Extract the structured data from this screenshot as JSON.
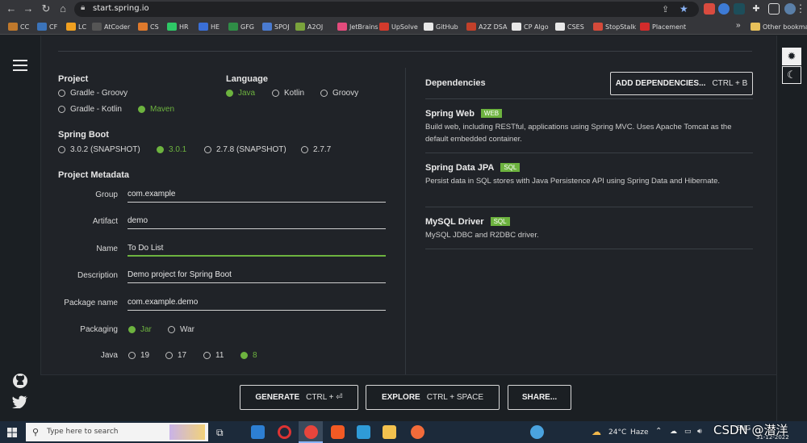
{
  "browser": {
    "url": "start.spring.io",
    "bookmarks": [
      {
        "label": "CC",
        "color": "#c0792c"
      },
      {
        "label": "CF",
        "color": "#3b73b9"
      },
      {
        "label": "LC",
        "color": "#f0a020"
      },
      {
        "label": "AtCoder",
        "color": "#555555"
      },
      {
        "label": "CS",
        "color": "#e07a2c"
      },
      {
        "label": "HR",
        "color": "#2ec866"
      },
      {
        "label": "HE",
        "color": "#3a6fd8"
      },
      {
        "label": "GFG",
        "color": "#2f8d46"
      },
      {
        "label": "SPOJ",
        "color": "#4a7bd0"
      },
      {
        "label": "A2OJ",
        "color": "#7aa33c"
      },
      {
        "label": "JetBrains",
        "color": "#e34b7c"
      },
      {
        "label": "UpSolve",
        "color": "#d33a2c"
      },
      {
        "label": "GitHub",
        "color": "#e8e8e8"
      },
      {
        "label": "A2Z DSA",
        "color": "#c2402a"
      },
      {
        "label": "CP Algo",
        "color": "#e8e8e8"
      },
      {
        "label": "CSES",
        "color": "#e8e8e8"
      },
      {
        "label": "StopStalk",
        "color": "#d44a3a"
      },
      {
        "label": "Placement",
        "color": "#d22b2b"
      }
    ],
    "overflow": "»",
    "other_bookmarks": "Other bookmarks"
  },
  "project": {
    "title": "Project",
    "options": [
      {
        "label": "Gradle - Groovy",
        "selected": false
      },
      {
        "label": "Gradle - Kotlin",
        "selected": false
      },
      {
        "label": "Maven",
        "selected": true
      }
    ]
  },
  "language": {
    "title": "Language",
    "options": [
      {
        "label": "Java",
        "selected": true
      },
      {
        "label": "Kotlin",
        "selected": false
      },
      {
        "label": "Groovy",
        "selected": false
      }
    ]
  },
  "spring_boot": {
    "title": "Spring Boot",
    "options": [
      {
        "label": "3.0.2 (SNAPSHOT)",
        "selected": false
      },
      {
        "label": "3.0.1",
        "selected": true
      },
      {
        "label": "2.7.8 (SNAPSHOT)",
        "selected": false
      },
      {
        "label": "2.7.7",
        "selected": false
      }
    ]
  },
  "metadata": {
    "title": "Project Metadata",
    "fields": [
      {
        "label": "Group",
        "value": "com.example"
      },
      {
        "label": "Artifact",
        "value": "demo"
      },
      {
        "label": "Name",
        "value": "To Do List"
      },
      {
        "label": "Description",
        "value": "Demo project for Spring Boot"
      },
      {
        "label": "Package name",
        "value": "com.example.demo"
      }
    ],
    "packaging": {
      "label": "Packaging",
      "options": [
        {
          "label": "Jar",
          "selected": true
        },
        {
          "label": "War",
          "selected": false
        }
      ]
    },
    "java": {
      "label": "Java",
      "options": [
        {
          "label": "19",
          "selected": false
        },
        {
          "label": "17",
          "selected": false
        },
        {
          "label": "11",
          "selected": false
        },
        {
          "label": "8",
          "selected": true
        }
      ]
    }
  },
  "dependencies": {
    "title": "Dependencies",
    "add_button": "ADD DEPENDENCIES...",
    "add_shortcut": "CTRL + B",
    "items": [
      {
        "name": "Spring Web",
        "badge": "WEB",
        "description": "Build web, including RESTful, applications using Spring MVC. Uses Apache Tomcat as the default embedded container."
      },
      {
        "name": "Spring Data JPA",
        "badge": "SQL",
        "description": "Persist data in SQL stores with Java Persistence API using Spring Data and Hibernate."
      },
      {
        "name": "MySQL Driver",
        "badge": "SQL",
        "description": "MySQL JDBC and R2DBC driver."
      }
    ]
  },
  "footer": {
    "generate": "GENERATE",
    "generate_shortcut": "CTRL + ⏎",
    "explore": "EXPLORE",
    "explore_shortcut": "CTRL + SPACE",
    "share": "SHARE..."
  },
  "taskbar": {
    "search_placeholder": "Type here to search",
    "weather_temp": "24°C",
    "weather_desc": "Haze",
    "lang": "ENG",
    "date": "31-12-2022",
    "watermark": "CSDN @潜洋"
  },
  "colors": {
    "accent": "#6db33f",
    "background": "#202328"
  }
}
